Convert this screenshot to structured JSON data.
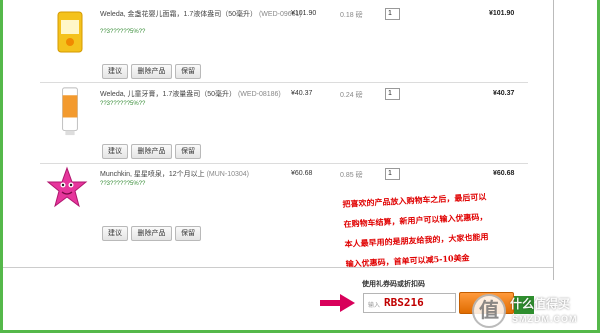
{
  "cart": {
    "items": [
      {
        "title": "Weleda, 金盏花婴儿面霜，1.7液体盎司（50毫升）",
        "sku": "(WED-09661)",
        "reward": "??3??????5%??",
        "price": "¥101.90",
        "weight": "0.18 磅",
        "qty": "1",
        "total": "¥101.90",
        "actions": [
          "建议",
          "删除产品",
          "保留"
        ]
      },
      {
        "title": "Weleda, 儿童牙膏，1.7液量盎司（50毫升）",
        "sku": "(WED-08186)",
        "reward": "??3??????5%??",
        "price": "¥40.37",
        "weight": "0.24 磅",
        "qty": "1",
        "total": "¥40.37",
        "actions": [
          "建议",
          "删除产品",
          "保留"
        ]
      },
      {
        "title": "Munchkin, 星星喷泉，12个月以上",
        "sku": "(MUN-10304)",
        "reward": "??3??????5%??",
        "price": "¥60.68",
        "weight": "0.85 磅",
        "qty": "1",
        "total": "¥60.68",
        "actions": [
          "建议",
          "删除产品",
          "保留"
        ]
      }
    ]
  },
  "note": {
    "lines": [
      "把喜欢的产品放入购物车之后，最后可以",
      "在购物车结算，新用户可以输入优惠码，",
      "本人最早用的是朋友给我的，大家也能用",
      "输入优惠码，首单可以减5-10美金"
    ]
  },
  "coupon": {
    "label": "使用礼券码或折扣码",
    "placeholder": "输入",
    "value": "RBS216"
  },
  "watermark": {
    "logo_char": "值",
    "text": "什么值得买",
    "url": "SMZDM.COM"
  },
  "colors": {
    "frame": "#55b84a",
    "note": "#e00000",
    "apply_button": "#f08a24",
    "arrow": "#d8005a"
  }
}
